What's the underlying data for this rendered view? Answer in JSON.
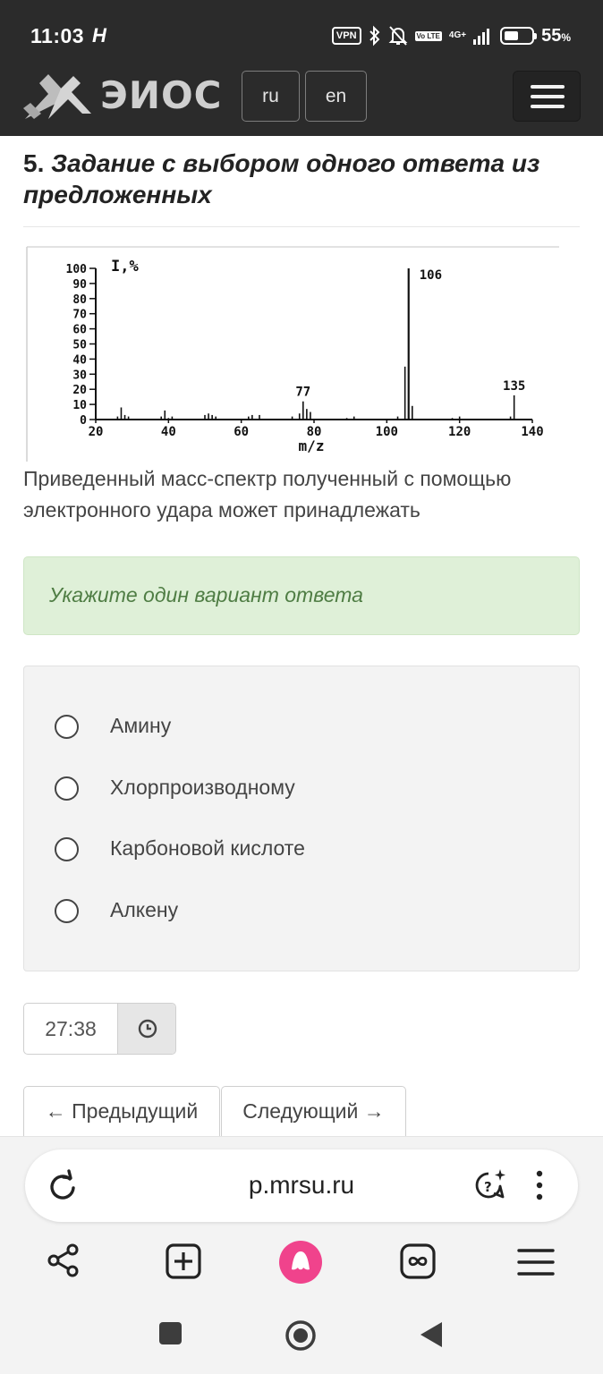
{
  "status_bar": {
    "time": "11:03",
    "extra_glyph": "H",
    "vpn": "VPN",
    "volte": "Vo LTE",
    "network": "4G+",
    "battery_percent": 55,
    "battery_text": "55",
    "battery_unit": "%"
  },
  "header": {
    "logo_text": "ЭИОС",
    "lang_ru": "ru",
    "lang_en": "en",
    "menu_icon": "hamburger-icon"
  },
  "question": {
    "number": "5.",
    "title": "Задание с выбором одного ответа из предложенных",
    "text": "Приведенный масс-спектр полученный с помощью электронного удара может принадлежать",
    "hint": "Укажите один вариант ответа",
    "options": [
      {
        "label": "Амину"
      },
      {
        "label": "Хлорпроизводному"
      },
      {
        "label": "Карбоновой кислоте"
      },
      {
        "label": "Алкену"
      }
    ]
  },
  "chart_data": {
    "type": "bar",
    "ylabel": "I,%",
    "xlabel": "m/z",
    "xlim": [
      20,
      140
    ],
    "ylim": [
      0,
      100
    ],
    "yticks": [
      "0",
      "10",
      "20",
      "30",
      "40",
      "50",
      "60",
      "70",
      "80",
      "90",
      "100"
    ],
    "xticks": [
      "20",
      "40",
      "60",
      "80",
      "100",
      "120",
      "140"
    ],
    "peak_labels": [
      {
        "x": 77,
        "label": "77"
      },
      {
        "x": 106,
        "label": "106"
      },
      {
        "x": 135,
        "label": "135"
      }
    ],
    "peaks": [
      {
        "x": 26,
        "y": 2
      },
      {
        "x": 27,
        "y": 8
      },
      {
        "x": 28,
        "y": 3
      },
      {
        "x": 29,
        "y": 2
      },
      {
        "x": 38,
        "y": 2
      },
      {
        "x": 39,
        "y": 6
      },
      {
        "x": 40,
        "y": 1
      },
      {
        "x": 41,
        "y": 2
      },
      {
        "x": 50,
        "y": 3
      },
      {
        "x": 51,
        "y": 4
      },
      {
        "x": 52,
        "y": 3
      },
      {
        "x": 53,
        "y": 2
      },
      {
        "x": 62,
        "y": 2
      },
      {
        "x": 63,
        "y": 3
      },
      {
        "x": 65,
        "y": 3
      },
      {
        "x": 74,
        "y": 2
      },
      {
        "x": 76,
        "y": 4
      },
      {
        "x": 77,
        "y": 12
      },
      {
        "x": 78,
        "y": 7
      },
      {
        "x": 79,
        "y": 5
      },
      {
        "x": 89,
        "y": 1
      },
      {
        "x": 91,
        "y": 2
      },
      {
        "x": 103,
        "y": 2
      },
      {
        "x": 105,
        "y": 35
      },
      {
        "x": 106,
        "y": 100
      },
      {
        "x": 107,
        "y": 9
      },
      {
        "x": 118,
        "y": 1
      },
      {
        "x": 120,
        "y": 2
      },
      {
        "x": 134,
        "y": 2
      },
      {
        "x": 135,
        "y": 16
      }
    ]
  },
  "timer": {
    "value": "27:38",
    "icon": "clock-icon"
  },
  "navigation": {
    "prev": "← Предыдущий",
    "next": "Следующий →"
  },
  "browser": {
    "url": "p.mrsu.ru",
    "toolbar_icons": [
      "share-icon",
      "new-tab-icon",
      "alice-icon",
      "tabs-icon",
      "menu-icon"
    ]
  }
}
